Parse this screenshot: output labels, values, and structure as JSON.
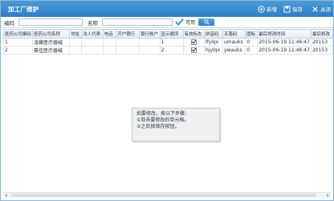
{
  "window": {
    "title": "加工厂维护",
    "ghost_menu": [
      "",
      "",
      ""
    ]
  },
  "toolbar": {
    "new_label": "新增",
    "save_label": "保存",
    "close_label": "关闭"
  },
  "filter": {
    "code_label": "编码",
    "code_value": "",
    "name_label": "名称",
    "name_value": "",
    "enabled_label": "可用",
    "enabled_checked": true
  },
  "table": {
    "columns": [
      "医药公司编码",
      "医药公司名称",
      "地址",
      "法人代表",
      "电话",
      "开户银行",
      "银行帐户",
      "显示顺序",
      "有效标志",
      "拼音码",
      "五笔码",
      "图标",
      "最后修改时间",
      "最后修改"
    ],
    "rows": [
      {
        "code": "1",
        "name": "凌峰医疗器械",
        "address": "",
        "legal": "",
        "phone": "",
        "bank": "",
        "account": "",
        "order": "1",
        "valid": true,
        "pinyin": "lfylqx",
        "wubi": "umauks",
        "icon": "0",
        "modified": "2015-06-19 11:46:47",
        "last": "20153"
      },
      {
        "code": "2",
        "name": "豪佳医疗器械",
        "address": "",
        "legal": "",
        "phone": "",
        "bank": "",
        "account": "",
        "order": "2",
        "valid": true,
        "pinyin": "hjylqx",
        "wubi": "ywauks",
        "icon": "0",
        "modified": "2015-06-19 11:46:47",
        "last": "20153"
      }
    ]
  },
  "tooltip": {
    "line1": "如要修改，按以下步骤:",
    "line2": "①双击要修改的单元格。",
    "line3": "②之后按保存按钮。"
  }
}
